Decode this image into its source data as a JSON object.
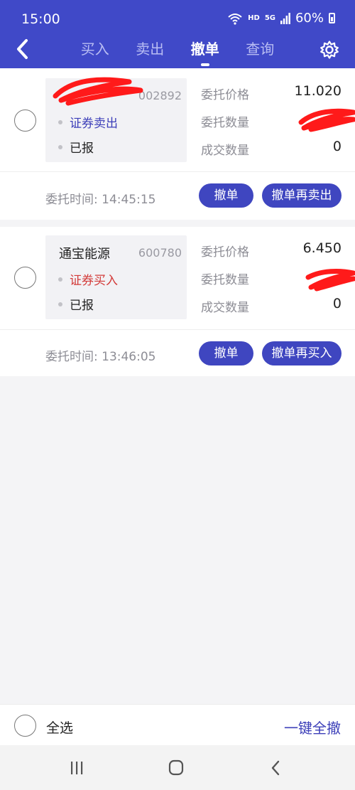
{
  "status_bar": {
    "time": "15:00",
    "hd": "HD",
    "network": "5G",
    "battery": "60%",
    "icons": [
      "wifi-icon",
      "signal-icon",
      "battery-icon"
    ]
  },
  "header": {
    "back_icon": "chevron-left-icon",
    "tabs": [
      {
        "label": "买入",
        "active": false
      },
      {
        "label": "卖出",
        "active": false
      },
      {
        "label": "撤单",
        "active": true
      },
      {
        "label": "查询",
        "active": false
      }
    ],
    "settings_icon": "gear-icon",
    "background": "#4049c8"
  },
  "orders": [
    {
      "name": "",
      "code": "002892",
      "type": "证券卖出",
      "type_color": "#3d3fb9",
      "status": "已报",
      "price_label": "委托价格",
      "price": "11.020",
      "quantity_label": "委托数量",
      "quantity": "",
      "filled_label": "成交数量",
      "filled": "0",
      "time_label": "委托时间: 14:45:15",
      "cancel_label": "撤单",
      "reorder_label": "撤单再卖出"
    },
    {
      "name": "通宝能源",
      "code": "600780",
      "type": "证券买入",
      "type_color": "#d33b39",
      "status": "已报",
      "price_label": "委托价格",
      "price": "6.450",
      "quantity_label": "委托数量",
      "quantity": "",
      "filled_label": "成交数量",
      "filled": "0",
      "time_label": "委托时间: 13:46:05",
      "cancel_label": "撤单",
      "reorder_label": "撤单再买入"
    }
  ],
  "footer": {
    "select_all_label": "全选",
    "cancel_all_label": "一键全撤"
  },
  "system_nav": [
    "recent-apps-icon",
    "home-icon",
    "back-icon"
  ],
  "colors": {
    "accent": "#3f46c0",
    "buy_red": "#d33b39",
    "sell_blue": "#3d3fb9"
  }
}
